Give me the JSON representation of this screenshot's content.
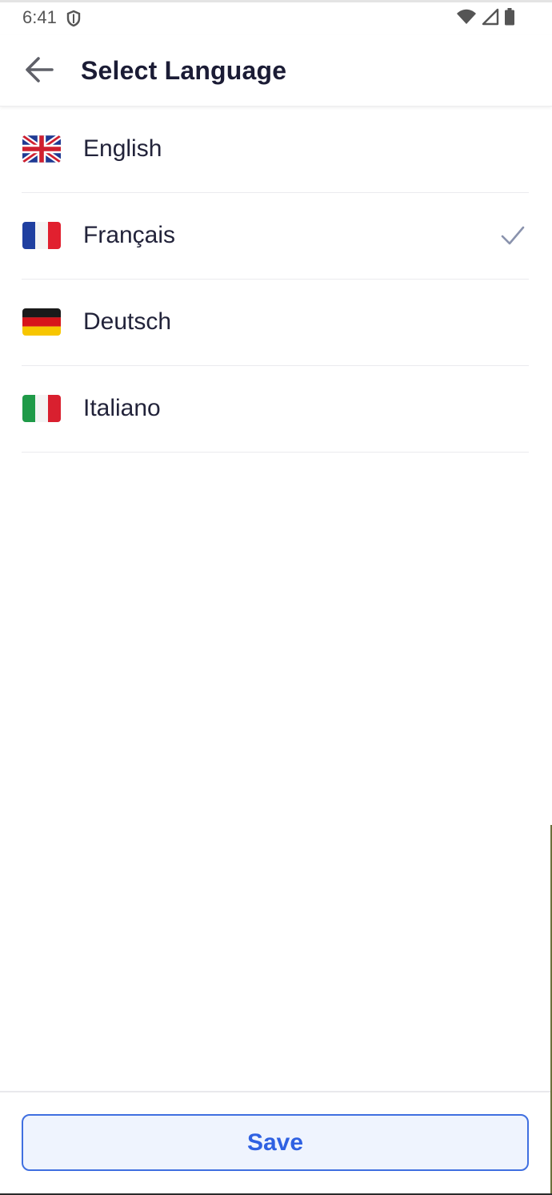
{
  "status_bar": {
    "time": "6:41",
    "icons": [
      "shield-icon",
      "wifi-icon",
      "cell-signal-icon",
      "battery-icon"
    ]
  },
  "app_bar": {
    "title": "Select Language",
    "back_icon": "arrow-left-icon"
  },
  "languages": [
    {
      "label": "English",
      "flag": "uk-flag-icon",
      "selected": false
    },
    {
      "label": "Français",
      "flag": "france-flag-icon",
      "selected": true
    },
    {
      "label": "Deutsch",
      "flag": "germany-flag-icon",
      "selected": false
    },
    {
      "label": "Italiano",
      "flag": "italy-flag-icon",
      "selected": false
    }
  ],
  "footer": {
    "save_label": "Save"
  },
  "colors": {
    "accent": "#2f61e2",
    "save_bg": "#eff4fe",
    "title_text": "#1b1c35",
    "check": "#8a93ad"
  }
}
